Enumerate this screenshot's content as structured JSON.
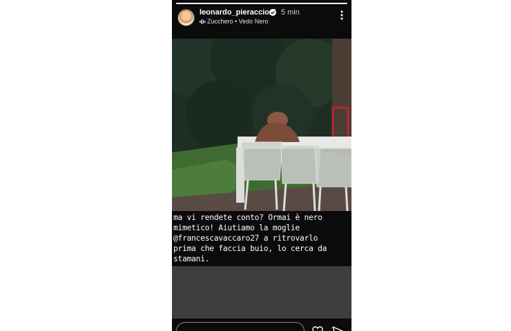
{
  "story": {
    "progress": 1.0,
    "username": "leonardo_pieraccioni",
    "time": "5 min",
    "music": "Zucchero • Vedo Nero",
    "caption_lines": [
      "ma vi rendete conto? Ormai è nero",
      "mimetico! Aiutiamo la moglie",
      "@francescavaccaro27 a ritrovarlo",
      "prima che faccia buio, lo cerca da",
      "stamani."
    ]
  },
  "icons": {
    "verified": "verified-badge-icon",
    "music": "audio-wave-icon",
    "more": "more-vertical-icon",
    "heart": "heart-icon",
    "send": "send-icon"
  },
  "colors": {
    "background": "#0b0b0b",
    "text": "#ffffff",
    "link_preview": "#3e3e3e",
    "verified": "#ffffff"
  }
}
